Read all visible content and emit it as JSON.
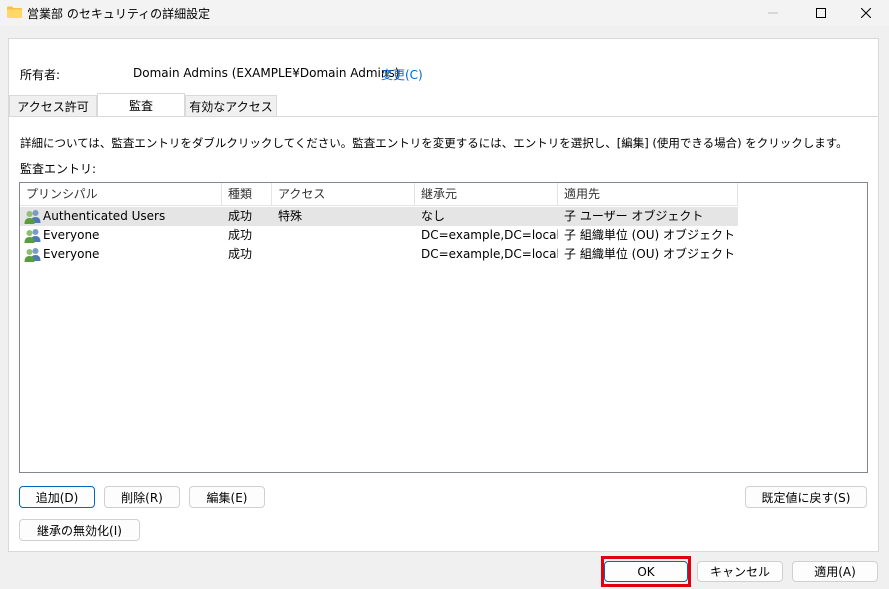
{
  "window": {
    "title": "営業部 のセキュリティの詳細設定",
    "folder_icon_color": "#f6c343"
  },
  "owner": {
    "label": "所有者:",
    "value": "Domain Admins (EXAMPLE¥Domain Admins)",
    "change_link": "変更(C)"
  },
  "tabs": [
    {
      "label": "アクセス許可",
      "active": false
    },
    {
      "label": "監査",
      "active": true
    },
    {
      "label": "有効なアクセス",
      "active": false
    }
  ],
  "description": "詳細については、監査エントリをダブルクリックしてください。監査エントリを変更するには、エントリを選択し、[編集] (使用できる場合) をクリックします。",
  "entries_label": "監査エントリ:",
  "columns": [
    "プリンシパル",
    "種類",
    "アクセス",
    "継承元",
    "適用先"
  ],
  "rows": [
    {
      "principal": "Authenticated Users",
      "type": "成功",
      "access": "特殊",
      "inherited_from": "なし",
      "applies_to": "子 ユーザー オブジェクト",
      "selected": true
    },
    {
      "principal": "Everyone",
      "type": "成功",
      "access": "",
      "inherited_from": "DC=example,DC=local",
      "applies_to": "子 組織単位 (OU) オブジェクト",
      "selected": false
    },
    {
      "principal": "Everyone",
      "type": "成功",
      "access": "",
      "inherited_from": "DC=example,DC=local",
      "applies_to": "子 組織単位 (OU) オブジェクト",
      "selected": false
    }
  ],
  "buttons": {
    "add": "追加(D)",
    "remove": "削除(R)",
    "edit": "編集(E)",
    "restore_defaults": "既定値に戻す(S)",
    "disable_inheritance": "継承の無効化(I)",
    "ok": "OK",
    "cancel": "キャンセル",
    "apply": "適用(A)"
  },
  "colors": {
    "link": "#0066cc",
    "highlight_box": "#e0000f",
    "selected_row": "#e5e5e5"
  }
}
